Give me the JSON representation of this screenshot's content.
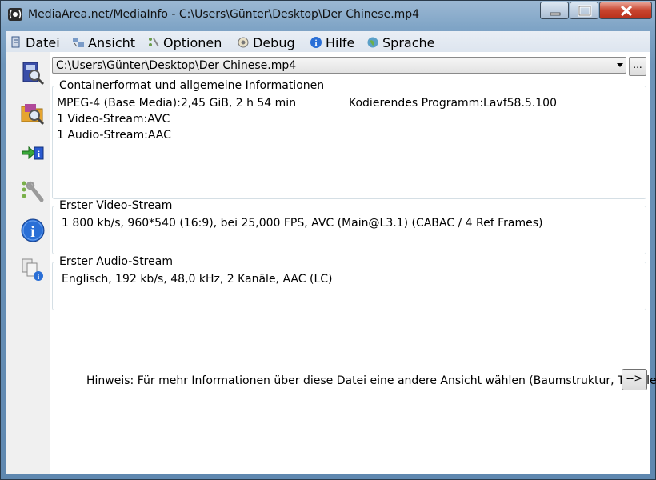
{
  "window": {
    "title": "MediaArea.net/MediaInfo - C:\\Users\\Günter\\Desktop\\Der Chinese.mp4"
  },
  "menu": {
    "items": [
      {
        "label": "Datei",
        "icon": "file-icon"
      },
      {
        "label": "Ansicht",
        "icon": "view-icon"
      },
      {
        "label": "Optionen",
        "icon": "options-icon"
      },
      {
        "label": "Debug",
        "icon": "debug-icon"
      },
      {
        "label": "Hilfe",
        "icon": "help-icon"
      },
      {
        "label": "Sprache",
        "icon": "globe-icon"
      }
    ]
  },
  "file": {
    "path": "C:\\Users\\Günter\\Desktop\\Der Chinese.mp4",
    "browse_label": "..."
  },
  "groups": {
    "general": {
      "title": "Containerformat und allgemeine Informationen",
      "format_line": "MPEG-4 (Base Media):2,45 GiB, 2 h 54 min",
      "encoder": "Kodierendes Programm:Lavf58.5.100",
      "video_count": "1 Video-Stream:AVC",
      "audio_count": "1 Audio-Stream:AAC"
    },
    "video": {
      "title": "Erster Video-Stream",
      "details": "1 800 kb/s, 960*540 (16:9), bei 25,000 FPS, AVC (Main@L3.1) (CABAC / 4 Ref Frames)"
    },
    "audio": {
      "title": "Erster Audio-Stream",
      "details": "Englisch, 192 kb/s, 48,0 kHz, 2 Kanäle, AAC (LC)"
    }
  },
  "footer": {
    "hint": "Hinweis: Für mehr Informationen über diese Datei eine andere Ansicht wählen (Baumstruktur, Tabelle...)",
    "next_label": "-->"
  },
  "sidebar": {
    "buttons": [
      "open-file-icon",
      "open-folder-icon",
      "export-icon",
      "preferences-icon",
      "about-icon",
      "file-compare-icon"
    ]
  }
}
